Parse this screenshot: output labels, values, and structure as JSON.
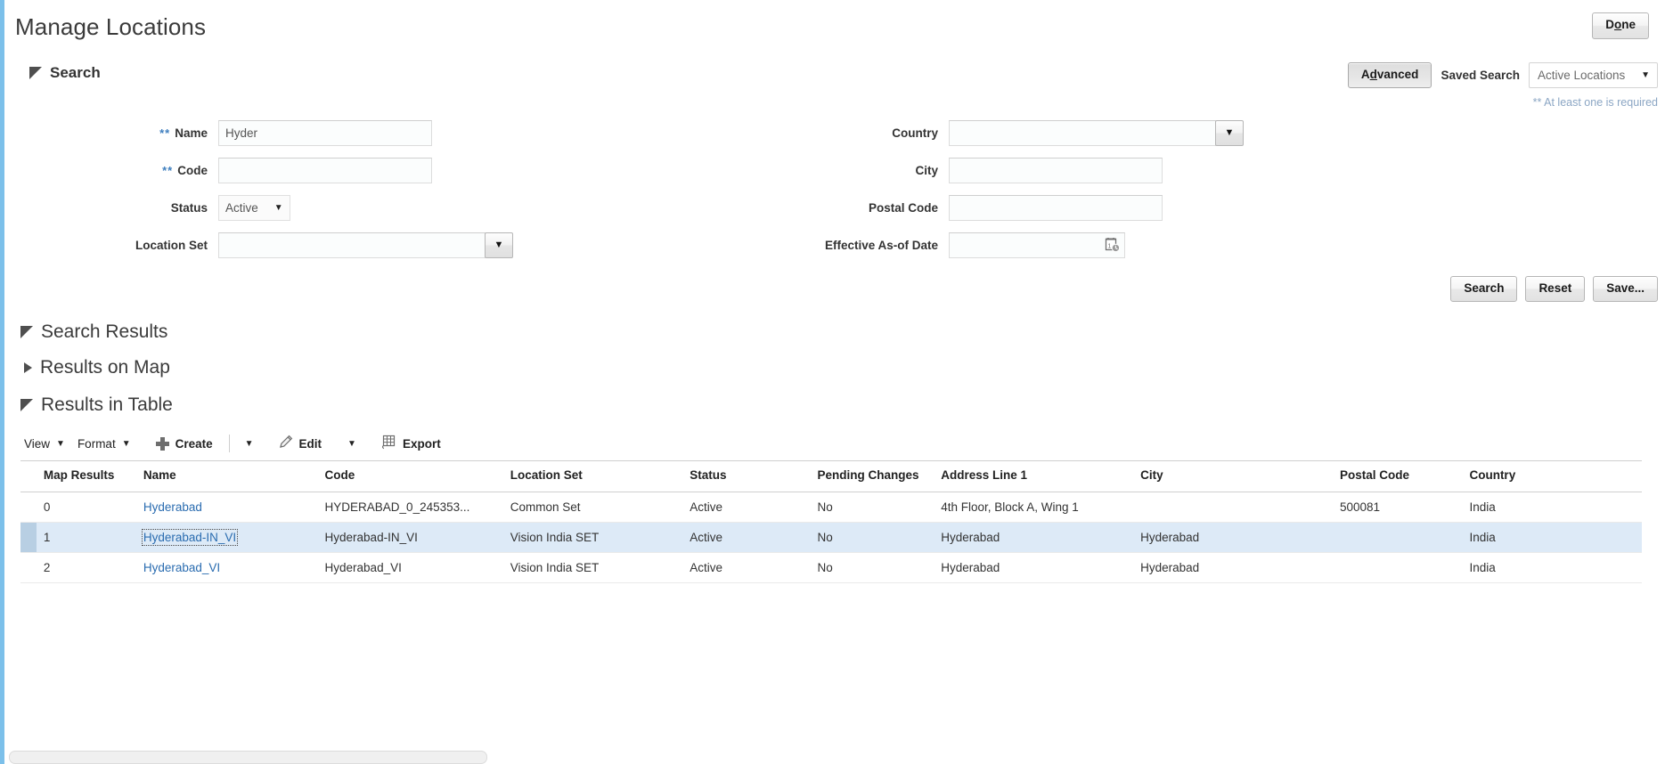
{
  "header": {
    "title": "Manage Locations",
    "done_label": "Done",
    "done_accesskey": "o"
  },
  "search": {
    "section_title": "Search",
    "advanced_label": "Advanced",
    "advanced_accesskey": "d",
    "saved_search_label": "Saved Search",
    "saved_search_value": "Active Locations",
    "required_note": "** At least one is required",
    "required_marker": "**",
    "fields": {
      "name": {
        "label": "Name",
        "value": "Hyder",
        "required": true
      },
      "code": {
        "label": "Code",
        "value": "",
        "required": true
      },
      "status": {
        "label": "Status",
        "value": "Active"
      },
      "location_set": {
        "label": "Location Set",
        "value": ""
      },
      "country": {
        "label": "Country",
        "value": ""
      },
      "city": {
        "label": "City",
        "value": ""
      },
      "postal_code": {
        "label": "Postal Code",
        "value": ""
      },
      "effective_date": {
        "label": "Effective As-of Date",
        "value": ""
      }
    },
    "buttons": {
      "search": "Search",
      "reset": "Reset",
      "save": "Save..."
    }
  },
  "results": {
    "section_title": "Search Results",
    "map_title": "Results on Map",
    "table_title": "Results in Table"
  },
  "toolbar": {
    "view": "View",
    "format": "Format",
    "create": "Create",
    "edit": "Edit",
    "export": "Export"
  },
  "table": {
    "columns": [
      "Map Results",
      "Name",
      "Code",
      "Location Set",
      "Status",
      "Pending Changes",
      "Address Line 1",
      "City",
      "Postal Code",
      "Country"
    ],
    "rows": [
      {
        "map_results": "0",
        "name": "Hyderabad",
        "code": "HYDERABAD_0_245353...",
        "location_set": "Common Set",
        "status": "Active",
        "pending_changes": "No",
        "address_line_1": "4th Floor, Block A, Wing 1",
        "city": "",
        "postal_code": "500081",
        "country": "India",
        "selected": false
      },
      {
        "map_results": "1",
        "name": "Hyderabad-IN_VI",
        "code": "Hyderabad-IN_VI",
        "location_set": "Vision India SET",
        "status": "Active",
        "pending_changes": "No",
        "address_line_1": "Hyderabad",
        "city": "Hyderabad",
        "postal_code": "",
        "country": "India",
        "selected": true
      },
      {
        "map_results": "2",
        "name": "Hyderabad_VI",
        "code": "Hyderabad_VI",
        "location_set": "Vision India SET",
        "status": "Active",
        "pending_changes": "No",
        "address_line_1": "Hyderabad",
        "city": "Hyderabad",
        "postal_code": "",
        "country": "India",
        "selected": false
      }
    ]
  },
  "colors": {
    "link": "#2a6cb0",
    "selected_row": "#ddeaf7",
    "accent_rail": "#7cc0ea",
    "required_blue": "#3f7fbf"
  }
}
